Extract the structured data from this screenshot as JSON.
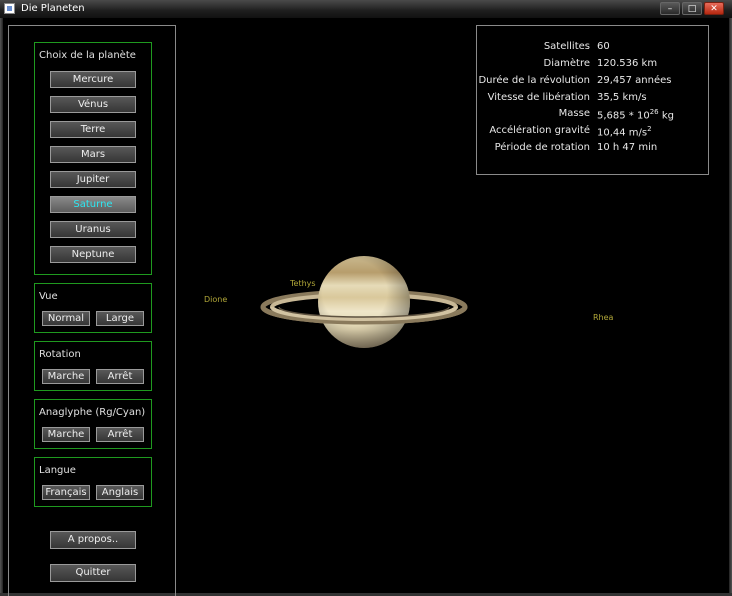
{
  "window": {
    "title": "Die Planeten"
  },
  "planet_group": {
    "label": "Choix de la planète",
    "planets": [
      "Mercure",
      "Vénus",
      "Terre",
      "Mars",
      "Jupiter",
      "Saturne",
      "Uranus",
      "Neptune"
    ],
    "selected": "Saturne"
  },
  "view_group": {
    "label": "Vue",
    "normal": "Normal",
    "large": "Large"
  },
  "rotation_group": {
    "label": "Rotation",
    "on": "Marche",
    "off": "Arrêt"
  },
  "anaglyph_group": {
    "label": "Anaglyphe (Rg/Cyan)",
    "on": "Marche",
    "off": "Arrêt"
  },
  "language_group": {
    "label": "Langue",
    "french": "Français",
    "english": "Anglais"
  },
  "about_button": "A propos..",
  "quit_button": "Quitter",
  "info": {
    "satellites_label": "Satellites",
    "satellites_value": "60",
    "diameter_label": "Diamètre",
    "diameter_value": "120.536 km",
    "revolution_label": "Durée de la révolution",
    "revolution_value": "29,457 années",
    "escape_label": "Vitesse de libération",
    "escape_value": "35,5 km/s",
    "mass_label": "Masse",
    "mass_base": "5,685 * 10",
    "mass_exp": "26",
    "mass_unit": "kg",
    "gravity_label": "Accélération gravité",
    "gravity_base": "10,44 m/s",
    "gravity_exp": "2",
    "rotation_label": "Période de rotation",
    "rotation_value": "10 h 47 min"
  },
  "moons": [
    "Dione",
    "Tethys",
    "Rhea"
  ],
  "colors": {
    "group_border": "#1f9a1f",
    "selected_text": "#2ee6f0",
    "moon_label": "#b0a638"
  }
}
